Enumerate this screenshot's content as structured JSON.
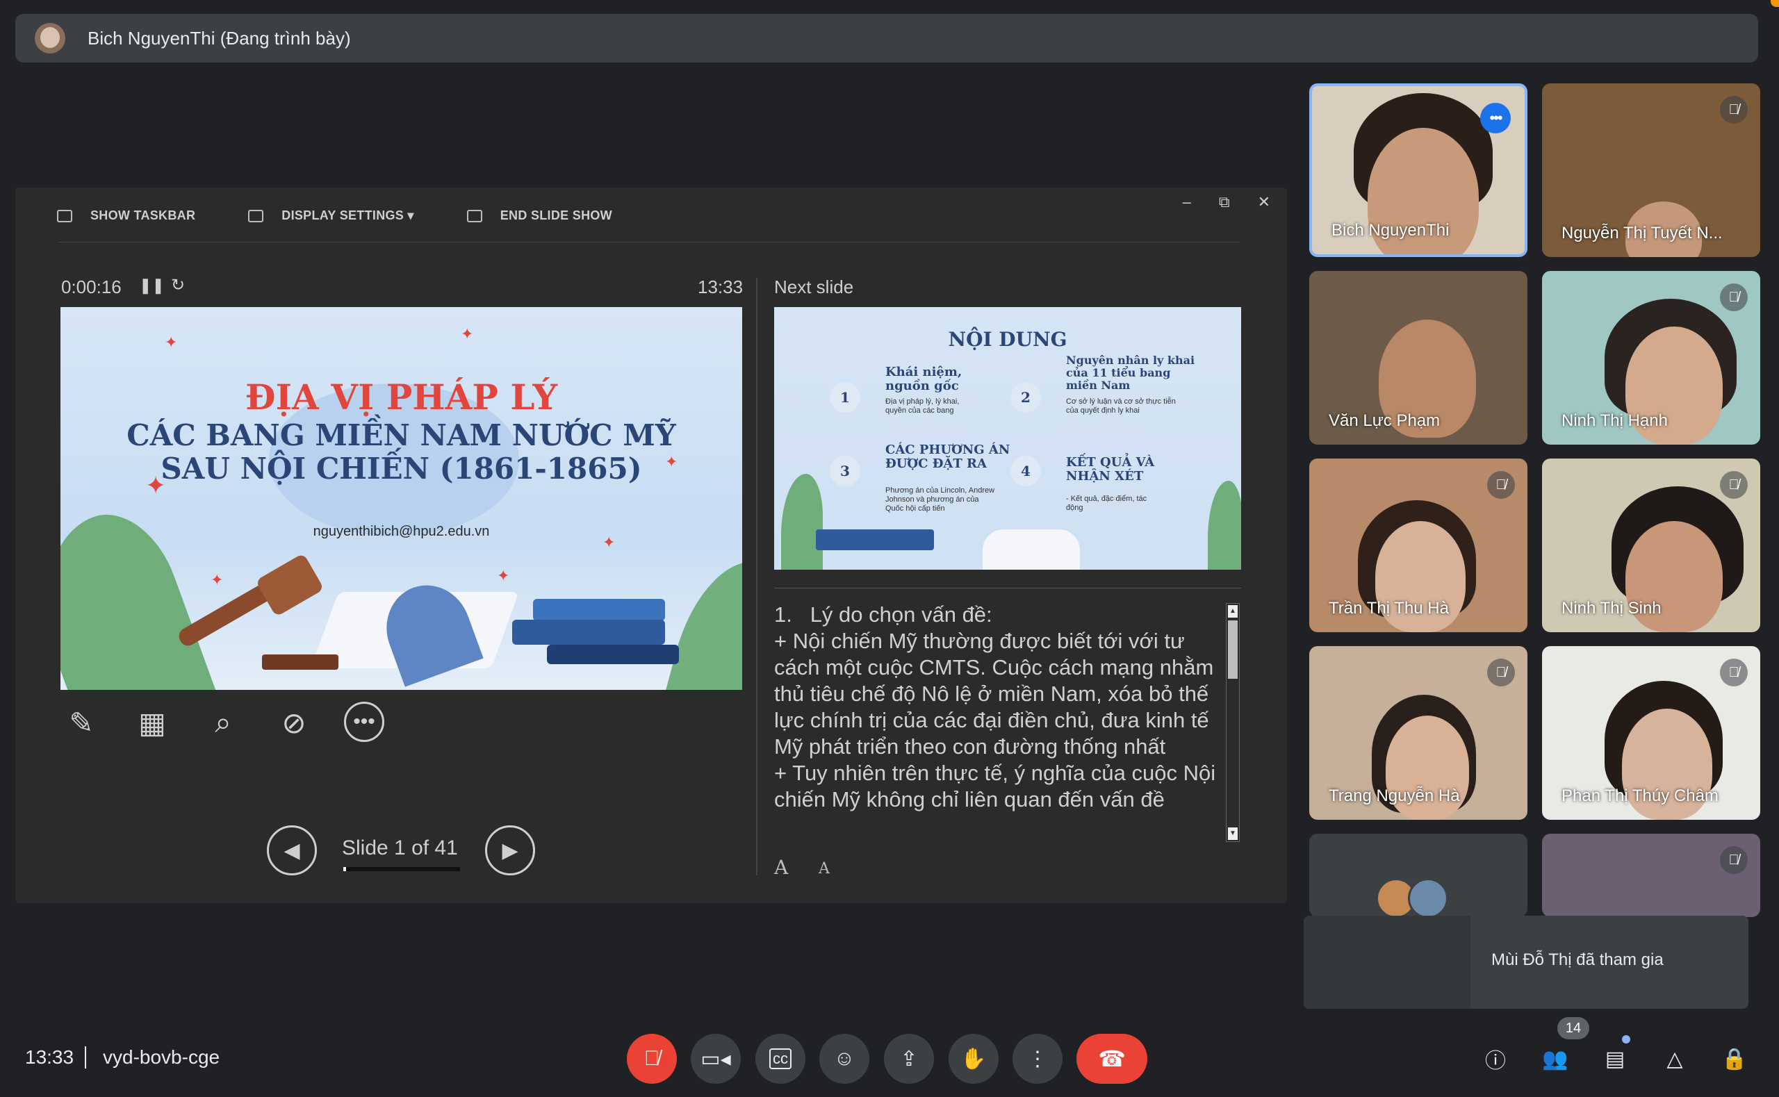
{
  "banner": {
    "presenter_text": "Bich NguyenThi (Đang trình bày)"
  },
  "slideshow": {
    "toolbar": {
      "show_taskbar": "SHOW TASKBAR",
      "display_settings": "DISPLAY SETTINGS ▾",
      "end_slide_show": "END SLIDE SHOW"
    },
    "window_controls": {
      "minimize": "–",
      "restore": "⧉",
      "close": "✕"
    },
    "elapsed": "0:00:16",
    "clock": "13:33",
    "next_slide_label": "Next slide",
    "current_slide": {
      "title_line1": "ĐỊA VỊ PHÁP LÝ",
      "title_line2": "CÁC BANG MIỀN NAM NƯỚC MỸ",
      "title_line3": "SAU NỘI CHIẾN (1861-1865)",
      "email": "nguyenthibich@hpu2.edu.vn"
    },
    "next_slide": {
      "title": "NỘI DUNG",
      "items": [
        {
          "num": "1",
          "heading": "Khái niệm, nguồn gốc",
          "sub": "Địa vị pháp lý, lý khai, quyền của các bang"
        },
        {
          "num": "2",
          "heading": "Nguyên nhân ly khai của 11 tiểu bang miền Nam",
          "sub": "Cơ sở lý luận và cơ sở thực tiễn của quyết định ly khai"
        },
        {
          "num": "3",
          "heading": "CÁC PHƯƠNG ÁN ĐƯỢC ĐẶT RA",
          "sub": "Phương án của Lincoln, Andrew Johnson và phương án của Quốc hội cấp tiến"
        },
        {
          "num": "4",
          "heading": "KẾT QUẢ VÀ NHẬN XÉT",
          "sub": "- Kết quả, đặc điểm, tác động"
        }
      ]
    },
    "notes": "1.   Lý do chọn vấn đề:\n+ Nội chiến Mỹ thường được biết tới với tư cách một cuộc CMTS. Cuộc cách mạng nhằm thủ tiêu chế độ Nô lệ ở miền Nam, xóa bỏ thế lực chính trị của các đại điền chủ, đưa kinh tế Mỹ phát triển theo con đường thống nhất\n+ Tuy nhiên trên thực tế, ý nghĩa của cuộc Nội chiến Mỹ không chỉ liên quan đến vấn đề",
    "slide_counter": "Slide 1 of 41",
    "slide_progress": 0.024,
    "font_increase": "A",
    "font_decrease": "A"
  },
  "participants": [
    {
      "name": "Bich NguyenThi",
      "muted": false,
      "speaking": true
    },
    {
      "name": "Nguyễn Thị Tuyết N...",
      "muted": true
    },
    {
      "name": "Văn Lực Phạm",
      "muted": false
    },
    {
      "name": "Ninh Thị Hạnh",
      "muted": true
    },
    {
      "name": "Trần Thị Thu Hà",
      "muted": true
    },
    {
      "name": "Ninh Thị Sinh",
      "muted": true
    },
    {
      "name": "Trang Nguyễn Hà",
      "muted": true
    },
    {
      "name": "Phan Thị Thúy Châm",
      "muted": true
    }
  ],
  "toast": {
    "text": "Mùi Đỗ Thị đã tham gia"
  },
  "bottom": {
    "time": "13:33",
    "meeting_code": "vyd-bovb-cge",
    "people_count": "14"
  },
  "icons": {
    "mic_off": "mic-off-icon",
    "camera": "camera-icon",
    "captions": "captions-icon",
    "emoji": "emoji-icon",
    "present": "present-icon",
    "hand": "raise-hand-icon",
    "more": "more-vert-icon",
    "hangup": "hang-up-icon",
    "info": "info-icon",
    "people": "people-icon",
    "chat": "chat-icon",
    "activities": "activities-icon",
    "lock": "host-controls-icon"
  },
  "colors": {
    "background": "#202124",
    "accent": "#8ab4f8",
    "danger": "#ea4335",
    "surface": "#3c4043"
  }
}
